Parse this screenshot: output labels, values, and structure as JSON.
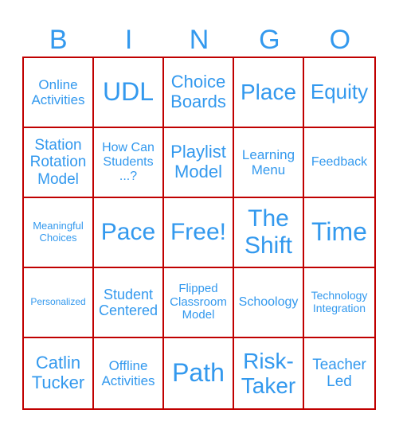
{
  "header": {
    "letters": [
      "B",
      "I",
      "N",
      "G",
      "O"
    ]
  },
  "colors": {
    "text": "#3399ee",
    "border": "#c00000"
  },
  "board": {
    "cells": [
      {
        "text": "Online Activities",
        "size": 17
      },
      {
        "text": "UDL",
        "size": 32
      },
      {
        "text": "Choice Boards",
        "size": 22
      },
      {
        "text": "Place",
        "size": 28
      },
      {
        "text": "Equity",
        "size": 26
      },
      {
        "text": "Station Rotation Model",
        "size": 19
      },
      {
        "text": "How Can Students ...?",
        "size": 16
      },
      {
        "text": "Playlist Model",
        "size": 22
      },
      {
        "text": "Learning Menu",
        "size": 17
      },
      {
        "text": "Feedback",
        "size": 16
      },
      {
        "text": "Meaningful Choices",
        "size": 13
      },
      {
        "text": "Pace",
        "size": 30
      },
      {
        "text": "Free!",
        "size": 30
      },
      {
        "text": "The Shift",
        "size": 30
      },
      {
        "text": "Time",
        "size": 32
      },
      {
        "text": "Personalized",
        "size": 12
      },
      {
        "text": "Student Centered",
        "size": 18
      },
      {
        "text": "Flipped Classroom Model",
        "size": 15
      },
      {
        "text": "Schoology",
        "size": 16
      },
      {
        "text": "Technology Integration",
        "size": 14
      },
      {
        "text": "Catlin Tucker",
        "size": 22
      },
      {
        "text": "Offline Activities",
        "size": 17
      },
      {
        "text": "Path",
        "size": 32
      },
      {
        "text": "Risk-Taker",
        "size": 28
      },
      {
        "text": "Teacher Led",
        "size": 19
      }
    ]
  }
}
